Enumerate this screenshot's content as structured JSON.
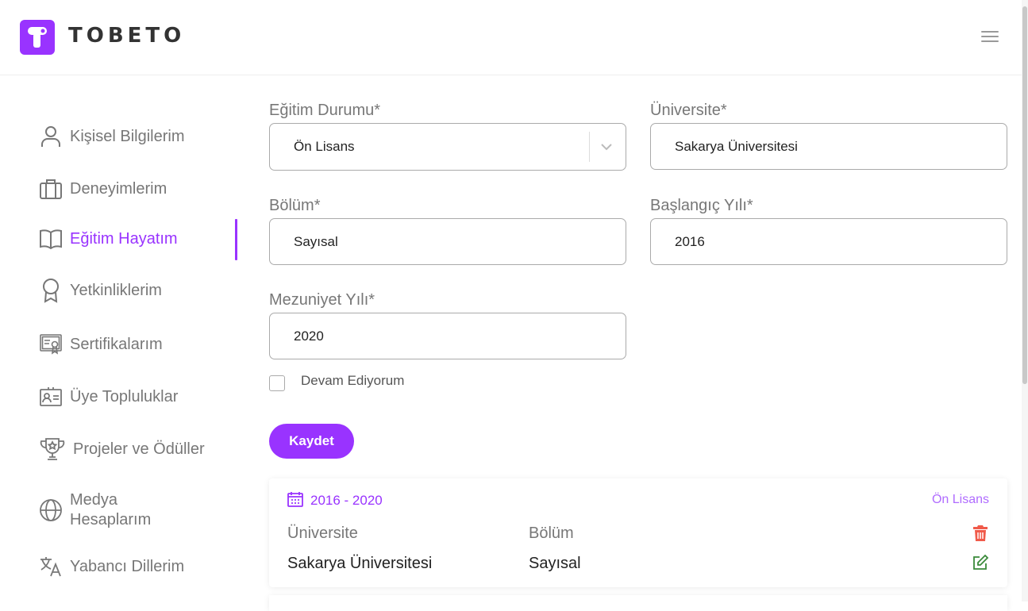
{
  "header": {
    "logo_text": "TOBETO",
    "menu_icon": "hamburger-menu-icon"
  },
  "sidebar": {
    "items": [
      {
        "label": "Kişisel Bilgilerim",
        "icon": "user-icon"
      },
      {
        "label": "Deneyimlerim",
        "icon": "briefcase-icon"
      },
      {
        "label": "Eğitim Hayatım",
        "icon": "book-icon",
        "active": true
      },
      {
        "label": "Yetkinliklerim",
        "icon": "award-ribbon-icon"
      },
      {
        "label": "Sertifikalarım",
        "icon": "certificate-icon"
      },
      {
        "label": "Üye Topluluklar",
        "icon": "id-card-icon"
      },
      {
        "label": "Projeler ve Ödüller",
        "icon": "trophy-icon"
      },
      {
        "label": "Medya Hesaplarım",
        "icon": "globe-icon"
      },
      {
        "label": "Yabancı Dillerim",
        "icon": "translate-icon"
      }
    ],
    "accent_color": "#9933ff"
  },
  "form": {
    "education_status": {
      "label": "Eğitim Durumu*",
      "value": "Ön Lisans"
    },
    "university": {
      "label": "Üniversite*",
      "value": "Sakarya Üniversitesi"
    },
    "department": {
      "label": "Bölüm*",
      "value": "Sayısal"
    },
    "start_year": {
      "label": "Başlangıç Yılı*",
      "value": "2016"
    },
    "graduation_year": {
      "label": "Mezuniyet Yılı*",
      "value": "2020"
    },
    "ongoing": {
      "label": "Devam Ediyorum",
      "checked": false
    },
    "save_label": "Kaydet"
  },
  "education_card": {
    "date_range": "2016 - 2020",
    "level": "Ön Lisans",
    "university_header": "Üniversite",
    "department_header": "Bölüm",
    "university_value": "Sakarya Üniversitesi",
    "department_value": "Sayısal",
    "delete_icon_color": "#f05a4a",
    "edit_icon_color": "#3a8a3a"
  }
}
